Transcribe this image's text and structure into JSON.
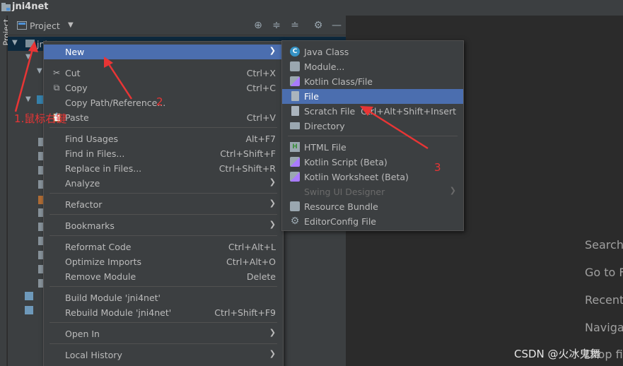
{
  "window": {
    "title": "jni4net"
  },
  "stripe": {
    "label": "Project"
  },
  "panel": {
    "view_label": "Project",
    "tree_items": [
      {
        "label": "jni"
      }
    ]
  },
  "menu_main": {
    "items": [
      {
        "label": "New",
        "shortcut": "",
        "submenu": true,
        "selected": true
      },
      {
        "label": "Cut",
        "shortcut": "Ctrl+X",
        "icon": "scissors-icon"
      },
      {
        "label": "Copy",
        "shortcut": "Ctrl+C",
        "icon": "copy-icon"
      },
      {
        "label": "Copy Path/Reference...",
        "shortcut": ""
      },
      {
        "label": "Paste",
        "shortcut": "Ctrl+V",
        "icon": "paste-icon"
      },
      {
        "label": "Find Usages",
        "shortcut": "Alt+F7"
      },
      {
        "label": "Find in Files...",
        "shortcut": "Ctrl+Shift+F"
      },
      {
        "label": "Replace in Files...",
        "shortcut": "Ctrl+Shift+R"
      },
      {
        "label": "Analyze",
        "shortcut": "",
        "submenu": true
      },
      {
        "label": "Refactor",
        "shortcut": "",
        "submenu": true
      },
      {
        "label": "Bookmarks",
        "shortcut": "",
        "submenu": true
      },
      {
        "label": "Reformat Code",
        "shortcut": "Ctrl+Alt+L"
      },
      {
        "label": "Optimize Imports",
        "shortcut": "Ctrl+Alt+O"
      },
      {
        "label": "Remove Module",
        "shortcut": "Delete"
      },
      {
        "label": "Build Module 'jni4net'",
        "shortcut": ""
      },
      {
        "label": "Rebuild Module 'jni4net'",
        "shortcut": "Ctrl+Shift+F9"
      },
      {
        "label": "Open In",
        "shortcut": "",
        "submenu": true
      },
      {
        "label": "Local History",
        "shortcut": "",
        "submenu": true
      }
    ]
  },
  "menu_new": {
    "items": [
      {
        "label": "Java Class",
        "icon": "java-class-icon",
        "icon_glyph": "C"
      },
      {
        "label": "Module...",
        "icon": "module-icon"
      },
      {
        "label": "Kotlin Class/File",
        "icon": "kotlin-icon"
      },
      {
        "label": "File",
        "icon": "file-icon",
        "selected": true
      },
      {
        "label": "Scratch File",
        "shortcut": "Ctrl+Alt+Shift+Insert",
        "icon": "scratch-file-icon"
      },
      {
        "label": "Directory",
        "icon": "folder-icon"
      },
      {
        "label": "HTML File",
        "icon": "html-file-icon",
        "icon_glyph": "H"
      },
      {
        "label": "Kotlin Script (Beta)",
        "icon": "kotlin-script-icon"
      },
      {
        "label": "Kotlin Worksheet (Beta)",
        "icon": "kotlin-worksheet-icon"
      },
      {
        "label": "Swing UI Designer",
        "disabled": true,
        "submenu": true
      },
      {
        "label": "Resource Bundle",
        "icon": "resource-bundle-icon"
      },
      {
        "label": "EditorConfig File",
        "icon": "gear-icon"
      }
    ]
  },
  "editor_hints": [
    "Search",
    "Go to F",
    "Recent",
    "Naviga",
    "Drop fi"
  ],
  "annotations": {
    "step1": "1.鼠标右键",
    "step2": "2",
    "step3": "3"
  },
  "watermark": "CSDN @火冰鬼舞",
  "colors": {
    "selection": "#4b6eaf",
    "annotation": "#e83535",
    "panel_bg": "#3c3f41",
    "editor_bg": "#2b2b2b"
  }
}
